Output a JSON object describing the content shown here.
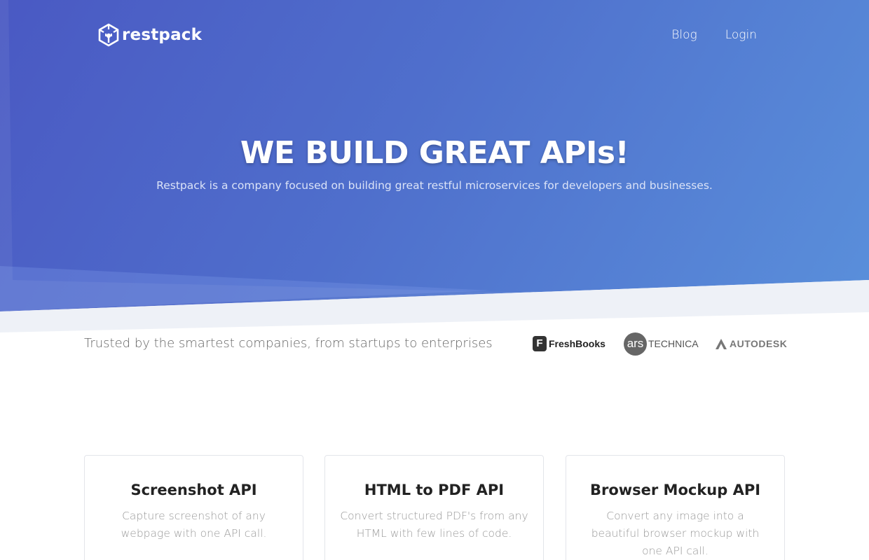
{
  "nav": {
    "logo_text": "restpack",
    "links": [
      {
        "label": "Blog"
      },
      {
        "label": "Login"
      }
    ]
  },
  "hero": {
    "title": "WE BUILD GREAT APIs!",
    "subtitle": "Restpack is a company focused on building great restful microservices for developers and businesses."
  },
  "trusted": {
    "text": "Trusted by the smartest companies, from startups to enterprises",
    "brands": [
      {
        "mark": "F",
        "name": "FreshBooks"
      },
      {
        "mark": "ars",
        "name": "TECHNICA"
      },
      {
        "name": "AUTODESK"
      }
    ]
  },
  "products": [
    {
      "title": "Screenshot API",
      "description": "Capture screenshot of any webpage with one API call."
    },
    {
      "title": "HTML to PDF API",
      "description": "Convert structured PDF's from any HTML with few lines of code."
    },
    {
      "title": "Browser Mockup API",
      "description": "Convert any image into a beautiful browser mockup with one API call."
    }
  ],
  "colors": {
    "hero_start": "#4a59c3",
    "hero_end": "#5a90db",
    "band": "#eef1f7",
    "card_border": "#e3e5ea"
  }
}
